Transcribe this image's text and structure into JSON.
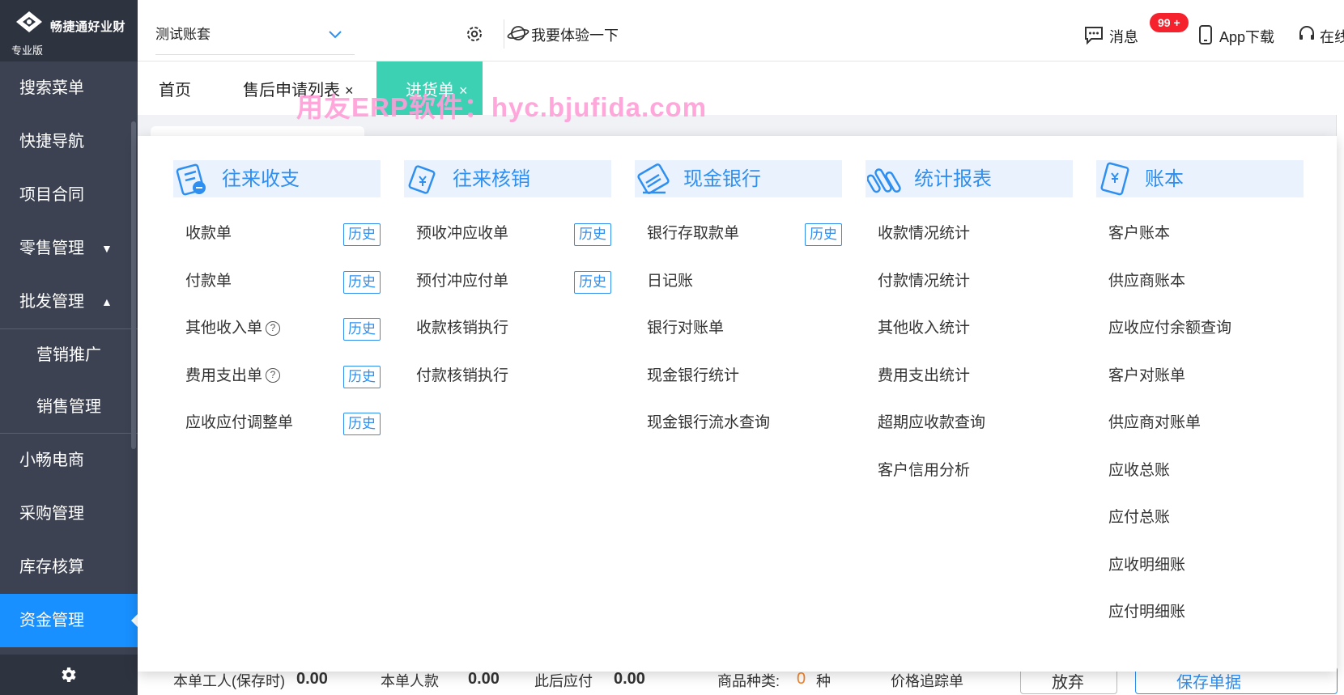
{
  "logo": {
    "name": "畅捷通好业财",
    "edition": "专业版"
  },
  "sidebar": {
    "items": [
      {
        "label": "搜索菜单"
      },
      {
        "label": "快捷导航"
      },
      {
        "label": "项目合同"
      },
      {
        "label": "零售管理",
        "caret": "▼"
      },
      {
        "label": "批发管理",
        "caret": "▲"
      }
    ],
    "subitems": [
      {
        "label": "营销推广"
      },
      {
        "label": "销售管理"
      }
    ],
    "items2": [
      {
        "label": "小畅电商"
      },
      {
        "label": "采购管理"
      },
      {
        "label": "库存核算"
      },
      {
        "label": "资金管理"
      }
    ]
  },
  "topbar": {
    "account": "测试账套",
    "try": "我要体验一下",
    "messages": "消息",
    "badge": "99 +",
    "app": "App下载",
    "online": "在线"
  },
  "tabs": [
    {
      "label": "首页"
    },
    {
      "label": "售后申请列表",
      "close": "×"
    },
    {
      "label": "进货单",
      "close": "×"
    }
  ],
  "watermark": "用友ERP软件：hyc.bjufida.com",
  "bottom": {
    "l1": "本单工人(保存时)",
    "v1": "0.00",
    "l2": "本单人款",
    "v2": "0.00",
    "l3": "此后应付",
    "v3": "0.00",
    "l4": "商品种类:",
    "v4": "0",
    "u4": "种",
    "l5": "价格追踪单",
    "b1": "放弃",
    "b2": "保存单据"
  },
  "menu": {
    "history_label": "历史",
    "columns": [
      {
        "title": "往来收支",
        "icon": "receipt-icon",
        "items": [
          {
            "label": "收款单",
            "history": true
          },
          {
            "label": "付款单",
            "history": true
          },
          {
            "label": "其他收入单",
            "help": true,
            "history": true
          },
          {
            "label": "费用支出单",
            "help": true,
            "history": true
          },
          {
            "label": "应收应付调整单",
            "history": true
          }
        ]
      },
      {
        "title": "往来核销",
        "icon": "voucher-icon",
        "items": [
          {
            "label": "预收冲应收单",
            "history": true
          },
          {
            "label": "预付冲应付单",
            "history": true
          },
          {
            "label": "收款核销执行"
          },
          {
            "label": "付款核销执行"
          }
        ]
      },
      {
        "title": "现金银行",
        "icon": "bank-icon",
        "items": [
          {
            "label": "银行存取款单",
            "history": true
          },
          {
            "label": "日记账"
          },
          {
            "label": "银行对账单"
          },
          {
            "label": "现金银行统计"
          },
          {
            "label": "现金银行流水查询"
          }
        ]
      },
      {
        "title": "统计报表",
        "icon": "report-icon",
        "items": [
          {
            "label": "收款情况统计"
          },
          {
            "label": "付款情况统计"
          },
          {
            "label": "其他收入统计"
          },
          {
            "label": "费用支出统计"
          },
          {
            "label": "超期应收款查询"
          },
          {
            "label": "客户信用分析"
          }
        ]
      },
      {
        "title": "账本",
        "icon": "ledger-icon",
        "items": [
          {
            "label": "客户账本"
          },
          {
            "label": "供应商账本"
          },
          {
            "label": "应收应付余额查询"
          },
          {
            "label": "客户对账单"
          },
          {
            "label": "供应商对账单"
          },
          {
            "label": "应收总账"
          },
          {
            "label": "应付总账"
          },
          {
            "label": "应收明细账"
          },
          {
            "label": "应付明细账"
          }
        ]
      }
    ]
  }
}
